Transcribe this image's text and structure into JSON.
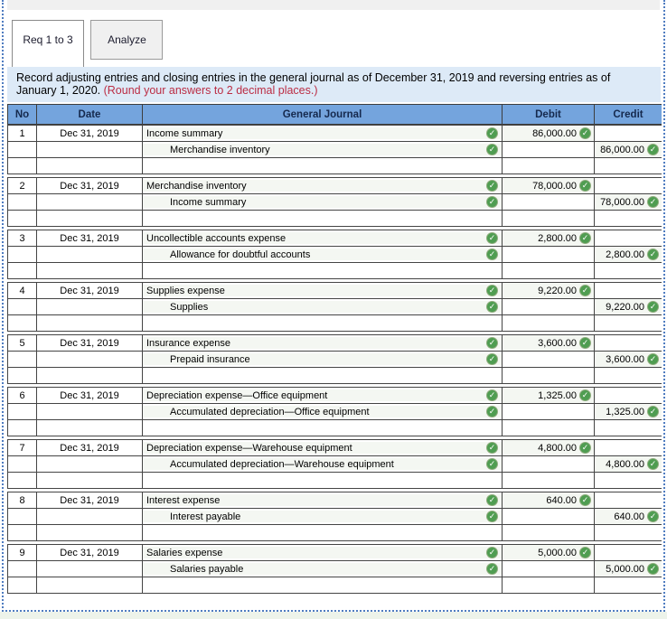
{
  "tabs": [
    {
      "label": "Req 1 to 3",
      "active": true
    },
    {
      "label": "Analyze",
      "active": false
    }
  ],
  "instruction": {
    "text": "Record adjusting entries and closing entries in the general journal as of December 31, 2019 and reversing entries as of January 1, 2020.",
    "note": "(Round your answers to 2 decimal places.)"
  },
  "journal": {
    "columns": [
      "No",
      "Date",
      "General Journal",
      "Debit",
      "Credit"
    ],
    "entries": [
      {
        "no": "1",
        "date": "Dec 31, 2019",
        "debit_account": "Income summary",
        "credit_account": "Merchandise inventory",
        "debit": "86,000.00",
        "credit": "86,000.00"
      },
      {
        "no": "2",
        "date": "Dec 31, 2019",
        "debit_account": "Merchandise inventory",
        "credit_account": "Income summary",
        "debit": "78,000.00",
        "credit": "78,000.00"
      },
      {
        "no": "3",
        "date": "Dec 31, 2019",
        "debit_account": "Uncollectible accounts expense",
        "credit_account": "Allowance for doubtful accounts",
        "debit": "2,800.00",
        "credit": "2,800.00"
      },
      {
        "no": "4",
        "date": "Dec 31, 2019",
        "debit_account": "Supplies expense",
        "credit_account": "Supplies",
        "debit": "9,220.00",
        "credit": "9,220.00"
      },
      {
        "no": "5",
        "date": "Dec 31, 2019",
        "debit_account": "Insurance expense",
        "credit_account": "Prepaid insurance",
        "debit": "3,600.00",
        "credit": "3,600.00"
      },
      {
        "no": "6",
        "date": "Dec 31, 2019",
        "debit_account": "Depreciation expense—Office equipment",
        "credit_account": "Accumulated depreciation—Office equipment",
        "debit": "1,325.00",
        "credit": "1,325.00"
      },
      {
        "no": "7",
        "date": "Dec 31, 2019",
        "debit_account": "Depreciation expense—Warehouse equipment",
        "credit_account": "Accumulated depreciation—Warehouse equipment",
        "debit": "4,800.00",
        "credit": "4,800.00"
      },
      {
        "no": "8",
        "date": "Dec 31, 2019",
        "debit_account": "Interest expense",
        "credit_account": "Interest payable",
        "debit": "640.00",
        "credit": "640.00"
      },
      {
        "no": "9",
        "date": "Dec 31, 2019",
        "debit_account": "Salaries expense",
        "credit_account": "Salaries payable",
        "debit": "5,000.00",
        "credit": "5,000.00"
      }
    ],
    "status_icon": "check-icon"
  },
  "colors": {
    "header_bg": "#74a4dd",
    "panel_bg": "#ddeaf7",
    "note_red": "#bb2d44",
    "check_green": "#4f9d51",
    "tab_active_bg": "#ffffff",
    "tab_inactive_bg": "#f0f0f0",
    "dashed_border": "#4f7cc0"
  },
  "icons": {
    "check_glyph": "✓"
  }
}
